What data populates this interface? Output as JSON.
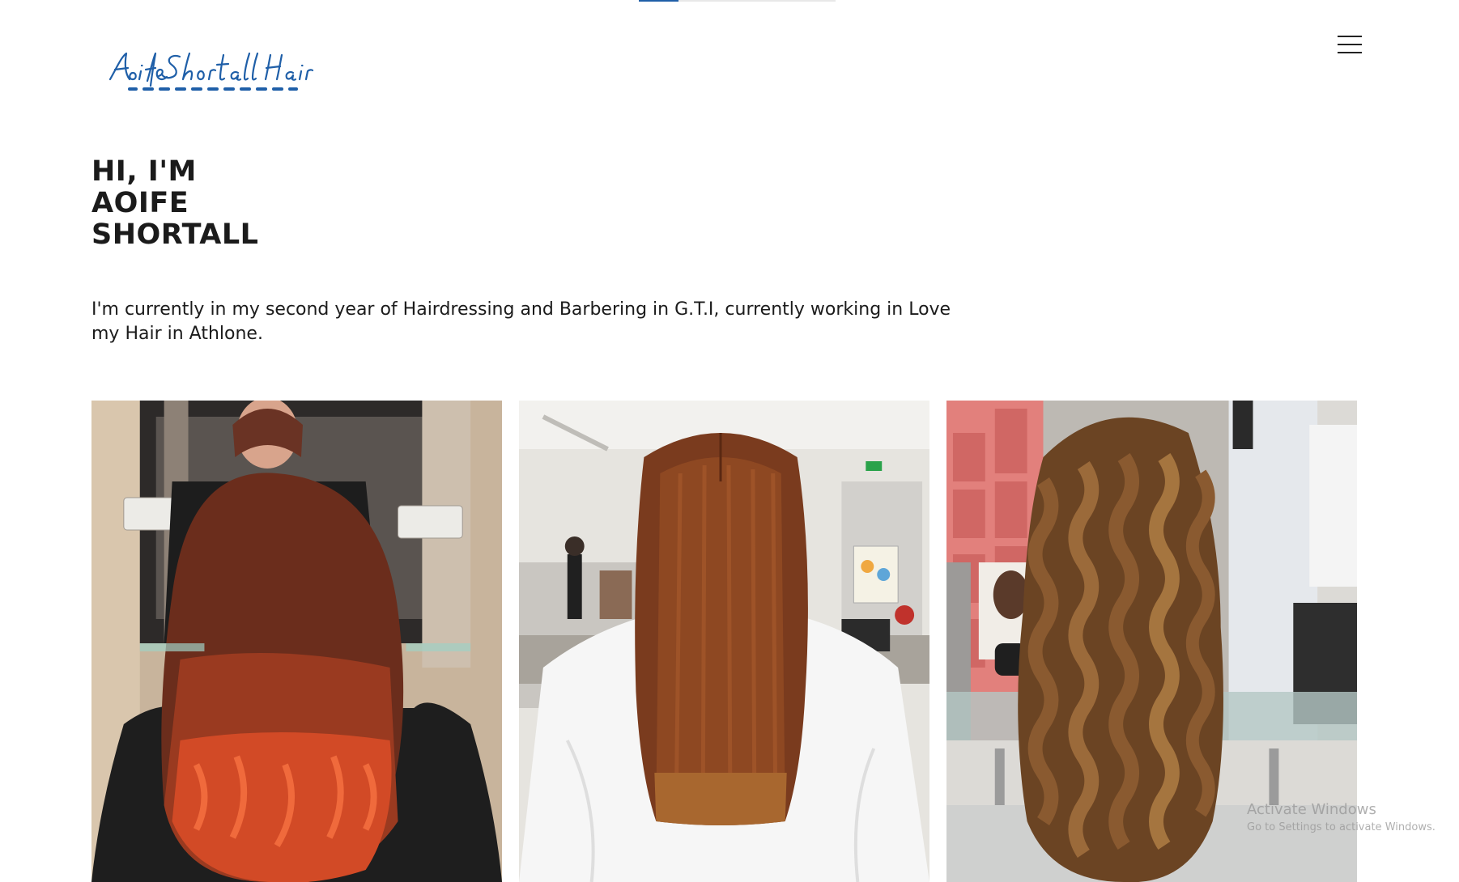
{
  "header": {
    "logo_text": "AoifeShortallHair",
    "menu_icon": "hamburger-menu-icon",
    "brand_color": "#1f5fa8",
    "scroll_progress": 0.2
  },
  "hero": {
    "title_lines": [
      "HI, I'M",
      "AOIFE",
      "SHORTALL"
    ],
    "intro": "I'm currently in my second year of Hairdressing and Barbering in G.T.I, currently working in Love my Hair in Athlone."
  },
  "gallery": {
    "photos": [
      {
        "name": "copper-balayage-curls-photo"
      },
      {
        "name": "straight-brunette-cut-photo"
      },
      {
        "name": "long-brown-waves-photo"
      }
    ]
  },
  "overlay": {
    "watermark_title": "Activate Windows",
    "watermark_subtitle": "Go to Settings to activate Windows."
  }
}
